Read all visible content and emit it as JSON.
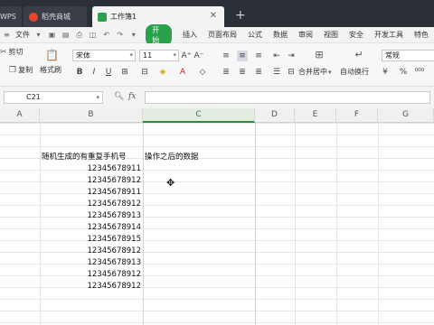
{
  "tabs": [
    {
      "label": "WPS"
    },
    {
      "label": "稻壳商城"
    },
    {
      "label": "工作簿1"
    }
  ],
  "menu": {
    "file": "文件",
    "start": "开始",
    "items": [
      "插入",
      "页面布局",
      "公式",
      "数据",
      "审阅",
      "视图",
      "安全",
      "开发工具",
      "特色"
    ]
  },
  "ribbon": {
    "cut": "剪切",
    "copy": "复制",
    "format_painter": "格式刷",
    "font_name": "宋体",
    "font_size": "11",
    "merge_center": "合并居中",
    "wrap_text": "自动换行",
    "number_format": "常规"
  },
  "formula_bar": {
    "cell_ref": "C21",
    "fx": "fx",
    "content": ""
  },
  "columns": [
    "A",
    "B",
    "C",
    "D",
    "E",
    "F",
    "G"
  ],
  "selected_column": "C",
  "sheet": {
    "b_header": "随机生成的有重复手机号",
    "c_header": "操作之后的数据",
    "b_values": [
      "12345678911",
      "12345678912",
      "12345678911",
      "12345678912",
      "12345678913",
      "12345678914",
      "12345678915",
      "12345678912",
      "12345678913",
      "12345678912",
      "12345678912"
    ]
  },
  "colors": {
    "accent": "#2aa14a",
    "titlebar": "#2b2f36"
  }
}
